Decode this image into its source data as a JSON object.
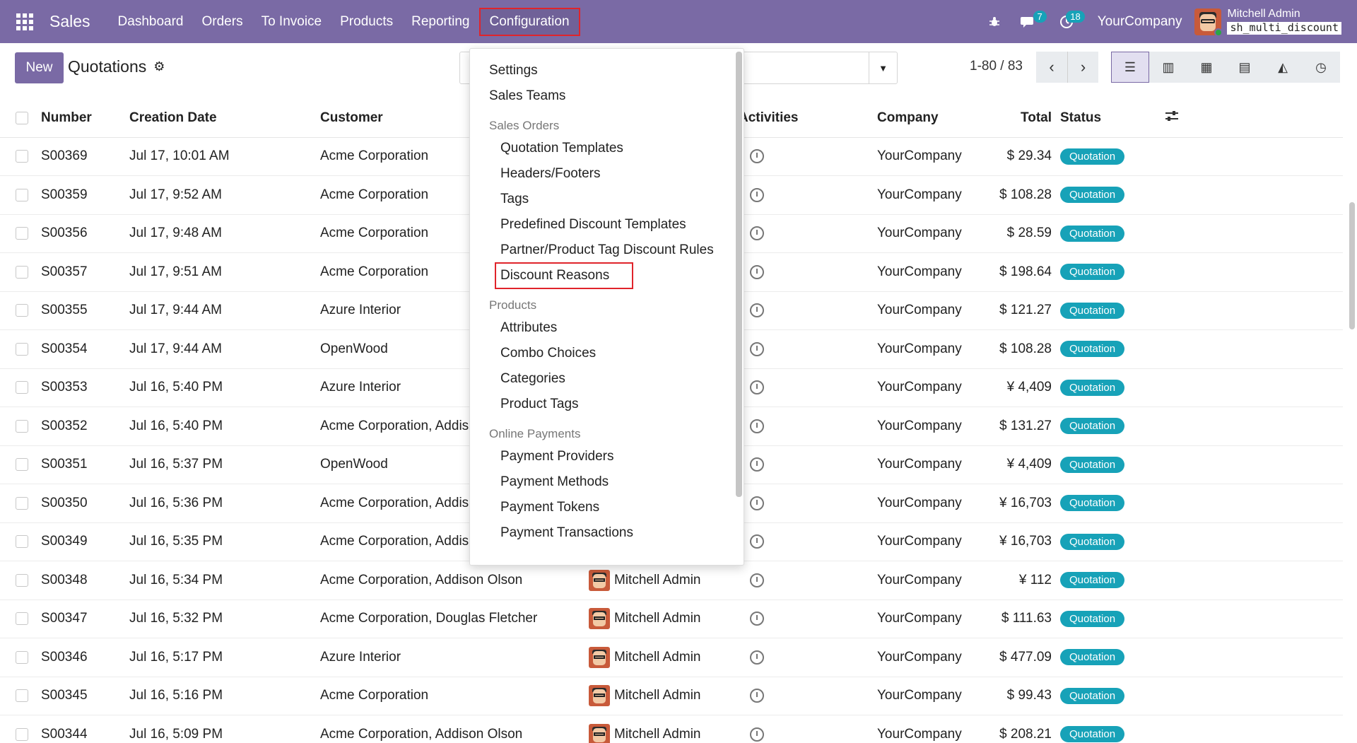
{
  "app": {
    "brand": "Sales",
    "menu": [
      "Dashboard",
      "Orders",
      "To Invoice",
      "Products",
      "Reporting",
      "Configuration"
    ]
  },
  "systray": {
    "messages_count": "7",
    "activities_count": "18",
    "company": "YourCompany",
    "user_name": "Mitchell Admin",
    "database": "sh_multi_discount"
  },
  "control": {
    "new_label": "New",
    "title": "Quotations",
    "pager": "1-80 / 83"
  },
  "table": {
    "headers": {
      "number": "Number",
      "creation_date": "Creation Date",
      "customer": "Customer",
      "activities": "Activities",
      "company": "Company",
      "total": "Total",
      "status": "Status"
    },
    "rows": [
      {
        "number": "S00369",
        "date": "Jul 17, 10:01 AM",
        "customer": "Acme Corporation",
        "salesperson": "",
        "company": "YourCompany",
        "total": "$ 29.34",
        "status": "Quotation"
      },
      {
        "number": "S00359",
        "date": "Jul 17, 9:52 AM",
        "customer": "Acme Corporation",
        "salesperson": "",
        "company": "YourCompany",
        "total": "$ 108.28",
        "status": "Quotation"
      },
      {
        "number": "S00356",
        "date": "Jul 17, 9:48 AM",
        "customer": "Acme Corporation",
        "salesperson": "",
        "company": "YourCompany",
        "total": "$ 28.59",
        "status": "Quotation"
      },
      {
        "number": "S00357",
        "date": "Jul 17, 9:51 AM",
        "customer": "Acme Corporation",
        "salesperson": "",
        "company": "YourCompany",
        "total": "$ 198.64",
        "status": "Quotation"
      },
      {
        "number": "S00355",
        "date": "Jul 17, 9:44 AM",
        "customer": "Azure Interior",
        "salesperson": "",
        "company": "YourCompany",
        "total": "$ 121.27",
        "status": "Quotation"
      },
      {
        "number": "S00354",
        "date": "Jul 17, 9:44 AM",
        "customer": "OpenWood",
        "salesperson": "",
        "company": "YourCompany",
        "total": "$ 108.28",
        "status": "Quotation"
      },
      {
        "number": "S00353",
        "date": "Jul 16, 5:40 PM",
        "customer": "Azure Interior",
        "salesperson": "",
        "company": "YourCompany",
        "total": "¥ 4,409",
        "status": "Quotation"
      },
      {
        "number": "S00352",
        "date": "Jul 16, 5:40 PM",
        "customer": "Acme Corporation, Addis",
        "salesperson": "",
        "company": "YourCompany",
        "total": "$ 131.27",
        "status": "Quotation"
      },
      {
        "number": "S00351",
        "date": "Jul 16, 5:37 PM",
        "customer": "OpenWood",
        "salesperson": "",
        "company": "YourCompany",
        "total": "¥ 4,409",
        "status": "Quotation"
      },
      {
        "number": "S00350",
        "date": "Jul 16, 5:36 PM",
        "customer": "Acme Corporation, Addis",
        "salesperson": "",
        "company": "YourCompany",
        "total": "¥ 16,703",
        "status": "Quotation"
      },
      {
        "number": "S00349",
        "date": "Jul 16, 5:35 PM",
        "customer": "Acme Corporation, Addis",
        "salesperson": "",
        "company": "YourCompany",
        "total": "¥ 16,703",
        "status": "Quotation"
      },
      {
        "number": "S00348",
        "date": "Jul 16, 5:34 PM",
        "customer": "Acme Corporation, Addison Olson",
        "salesperson": "Mitchell Admin",
        "company": "YourCompany",
        "total": "¥ 112",
        "status": "Quotation"
      },
      {
        "number": "S00347",
        "date": "Jul 16, 5:32 PM",
        "customer": "Acme Corporation, Douglas Fletcher",
        "salesperson": "Mitchell Admin",
        "company": "YourCompany",
        "total": "$ 111.63",
        "status": "Quotation"
      },
      {
        "number": "S00346",
        "date": "Jul 16, 5:17 PM",
        "customer": "Azure Interior",
        "salesperson": "Mitchell Admin",
        "company": "YourCompany",
        "total": "$ 477.09",
        "status": "Quotation"
      },
      {
        "number": "S00345",
        "date": "Jul 16, 5:16 PM",
        "customer": "Acme Corporation",
        "salesperson": "Mitchell Admin",
        "company": "YourCompany",
        "total": "$ 99.43",
        "status": "Quotation"
      },
      {
        "number": "S00344",
        "date": "Jul 16, 5:09 PM",
        "customer": "Acme Corporation, Addison Olson",
        "salesperson": "Mitchell Admin",
        "company": "YourCompany",
        "total": "$ 208.21",
        "status": "Quotation"
      }
    ]
  },
  "dropdown": {
    "items": [
      {
        "type": "item",
        "label": "Settings"
      },
      {
        "type": "item",
        "label": "Sales Teams"
      },
      {
        "type": "header",
        "label": "Sales Orders"
      },
      {
        "type": "sub",
        "label": "Quotation Templates"
      },
      {
        "type": "sub",
        "label": "Headers/Footers"
      },
      {
        "type": "sub",
        "label": "Tags"
      },
      {
        "type": "sub",
        "label": "Predefined Discount Templates"
      },
      {
        "type": "sub",
        "label": "Partner/Product Tag Discount Rules"
      },
      {
        "type": "sub",
        "label": "Discount Reasons",
        "highlight": true
      },
      {
        "type": "header",
        "label": "Products"
      },
      {
        "type": "sub",
        "label": "Attributes"
      },
      {
        "type": "sub",
        "label": "Combo Choices"
      },
      {
        "type": "sub",
        "label": "Categories"
      },
      {
        "type": "sub",
        "label": "Product Tags"
      },
      {
        "type": "header",
        "label": "Online Payments"
      },
      {
        "type": "sub",
        "label": "Payment Providers"
      },
      {
        "type": "sub",
        "label": "Payment Methods"
      },
      {
        "type": "sub",
        "label": "Payment Tokens"
      },
      {
        "type": "sub",
        "label": "Payment Transactions"
      }
    ]
  },
  "colors": {
    "brand": "#7a6aa5",
    "status_badge": "#17a2b8",
    "highlight_box": "#e0242b"
  },
  "icons": [
    "apps-grid-icon",
    "bug-icon",
    "chat-icon",
    "clock-icon",
    "settings-gear-icon",
    "chevron-left-icon",
    "chevron-right-icon",
    "list-view-icon",
    "kanban-view-icon",
    "calendar-view-icon",
    "pivot-view-icon",
    "graph-view-icon",
    "activity-view-icon",
    "optional-columns-icon"
  ]
}
